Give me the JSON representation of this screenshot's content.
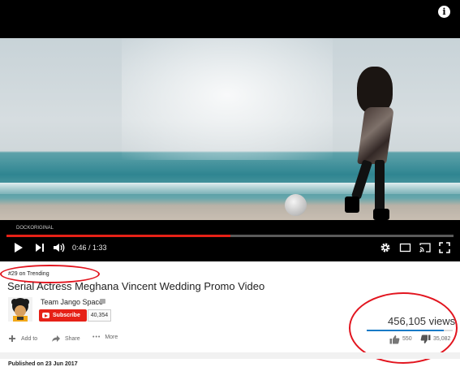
{
  "player": {
    "watermark": "DOCKORIGINAL",
    "current_time": "0:46",
    "duration": "1:33",
    "time_display": "0:46 / 1:33",
    "progress_fraction": 0.5
  },
  "video": {
    "trending_badge": "#29 on Trending",
    "title": "Serial Actress Meghana Vincent Wedding Promo Video",
    "channel_name": "Team Jango Space",
    "subscribe_label": "Subscribe",
    "subscriber_count": "40,354",
    "views": "456,105 views",
    "like_count": "550",
    "dislike_count": "35,082",
    "like_ratio": 0.9,
    "actions": {
      "add_to": "Add to",
      "share": "Share",
      "more": "More"
    },
    "published": "Published on 23 Jun 2017"
  },
  "colors": {
    "accent": "#e62117",
    "annotation": "#e2151f",
    "like_bar": "#167ac6"
  },
  "icons": {
    "play": "play-icon",
    "next": "next-icon",
    "volume": "volume-icon",
    "settings": "gear-icon",
    "miniplayer": "miniplayer-icon",
    "cast": "cast-icon",
    "fullscreen": "fullscreen-icon",
    "info": "info-icon"
  }
}
